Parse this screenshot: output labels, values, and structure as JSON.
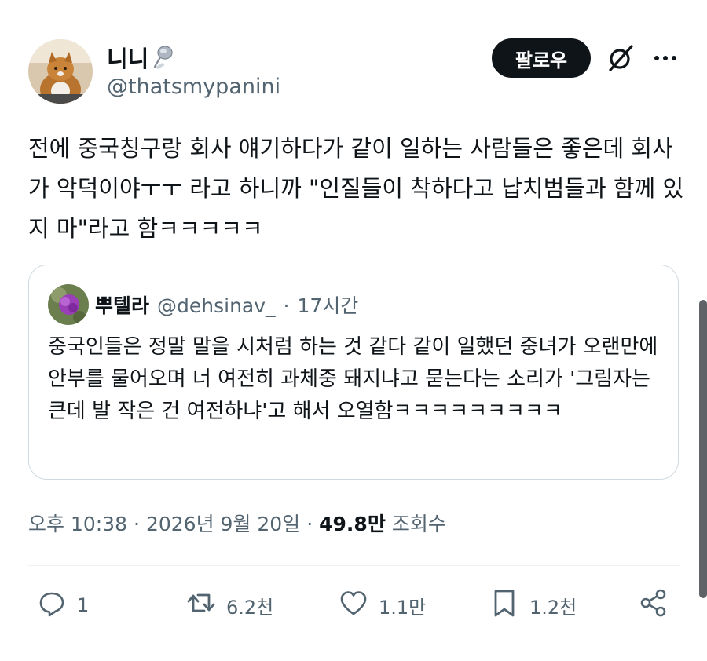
{
  "author": {
    "display_name": "니니",
    "handle": "@thatsmypanini",
    "follow_label": "팔로우"
  },
  "tweet": {
    "text": "전에 중국칭구랑 회사 얘기하다가 같이 일하는 사람들은 좋은데 회사가 악덕이야ㅜㅜ 라고 하니까 \"인질들이 착하다고 납치범들과 함께 있지 마\"라고 함ㅋㅋㅋㅋㅋ",
    "time": "오후 10:38",
    "sep1": "·",
    "date": "2026년 9월 20일",
    "sep2": "·",
    "views_count": "49.8만",
    "views_label": "조회수"
  },
  "quote": {
    "display_name": "뿌텔라",
    "handle": "@dehsinav_",
    "separator": "·",
    "time": "17시간",
    "text": "중국인들은 정말 말을 시처럼 하는 것 같다 같이 일했던 중녀가 오랜만에 안부를 물어오며 너 여전히 과체중 돼지냐고 묻는다는 소리가 '그림자는 큰데 발 작은 건 여전하냐'고 해서 오열함ㅋㅋㅋㅋㅋㅋㅋㅋㅋ"
  },
  "actions": {
    "reply": {
      "icon": "reply-icon",
      "count": "1"
    },
    "retweet": {
      "icon": "retweet-icon",
      "count": "6.2천"
    },
    "like": {
      "icon": "heart-icon",
      "count": "1.1만"
    },
    "bookmark": {
      "icon": "bookmark-icon",
      "count": "1.2천"
    },
    "share": {
      "icon": "share-icon"
    }
  },
  "colors": {
    "primary_text": "#0f1419",
    "secondary_text": "#536471",
    "border": "#cfd9de",
    "follow_bg": "#0f1419"
  }
}
